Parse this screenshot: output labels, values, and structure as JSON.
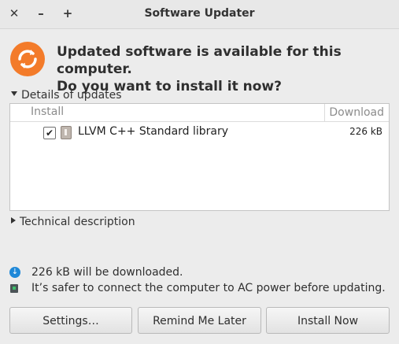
{
  "window": {
    "title": "Software Updater",
    "close_glyph": "✕",
    "minimize_glyph": "–",
    "maximize_glyph": "+"
  },
  "header": {
    "icon": "update-refresh-icon",
    "message_line1": "Updated software is available for this computer.",
    "message_line2": "Do you want to install it now?"
  },
  "details": {
    "expander_label": "Details of updates",
    "expanded": true,
    "columns": {
      "install": "Install",
      "download": "Download"
    },
    "rows": [
      {
        "checked": true,
        "name": "LLVM C++ Standard library",
        "size": "226 kB",
        "icon": "package-icon"
      }
    ]
  },
  "technical": {
    "expander_label": "Technical description",
    "expanded": false
  },
  "info": {
    "download_text": "226 kB will be downloaded.",
    "power_text": "It’s safer to connect the computer to AC power before updating."
  },
  "buttons": {
    "settings": "Settings…",
    "remind": "Remind Me Later",
    "install": "Install Now"
  },
  "colors": {
    "accent": "#f37b2a",
    "download_icon": "#1e88d8"
  }
}
